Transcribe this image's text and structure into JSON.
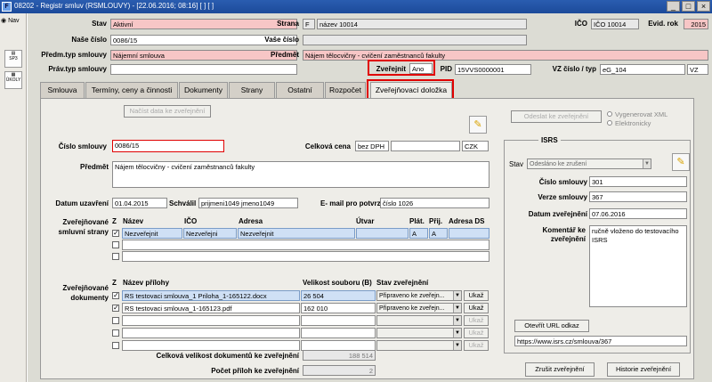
{
  "window": {
    "title": "08202 - Registr smluv (RSMLOUVY) - [22.06.2016; 08:16] [ ] [ ]"
  },
  "left": {
    "nav_label": "Nav",
    "sp3_label": "SP3",
    "ukoly_label": "ÚKOLY"
  },
  "header": {
    "stav_label": "Stav",
    "stav_value": "Aktivní",
    "strana_label": "Strana",
    "strana_code": "F",
    "strana_name": "název 10014",
    "ico_label": "IČO",
    "ico_value": "IČO 10014",
    "evid_label": "Evid. rok",
    "evid_value": "2015",
    "nase_label": "Naše číslo",
    "nase_value": "0086/15",
    "vase_label": "Vaše číslo",
    "vase_value": "",
    "predm_typ_label": "Předm.typ smlouvy",
    "predm_typ_value": "Nájemní smlouva",
    "predmet_label": "Předmět",
    "predmet_value": "Nájem tělocvičny - cvičení zaměstnanců fakulty",
    "prav_label": "Práv.typ smlouvy",
    "prav_value": "",
    "zverejnit_label": "Zveřejnit",
    "zverejnit_value": "Ano",
    "pid_label": "PID",
    "pid_value": "15VVS0000001",
    "vz_label": "VZ číslo / typ",
    "vz_value": "eG_104",
    "vz_type": "VZ"
  },
  "tabs": [
    "Smlouva",
    "Termíny, ceny a činnosti",
    "Dokumenty",
    "Strany",
    "Ostatní",
    "Rozpočet",
    "Zveřejňovací doložka"
  ],
  "panel": {
    "nacist_btn": "Načíst data ke zveřejnění",
    "odeslat_btn": "Odeslat ke zveřejnění",
    "radio_xml": "Vygenerovat XML",
    "radio_el": "Elektronicky",
    "cislo_label": "Číslo smlouvy",
    "cislo_value": "0086/15",
    "celkova_label": "Celková cena",
    "celkova_dph": "bez DPH",
    "celkova_value": "",
    "mena": "CZK",
    "predmet_label": "Předmět",
    "predmet_value": "Nájem tělocvičny - cvičení zaměstnanců fakulty",
    "datum_label": "Datum uzavření",
    "datum_value": "01.04.2015",
    "schvalil_label": "Schválil",
    "schvalil_value": "prijmeni1049 jmeno1049",
    "email_label": "E- mail pro potvrzení",
    "email_value": "číslo 1026",
    "strany_label": "Zveřejňované smluvní strany",
    "strany_cols": [
      "Z",
      "Název",
      "IČO",
      "Adresa",
      "Útvar",
      "Plát.",
      "Přij.",
      "Adresa DS"
    ],
    "strany_row": {
      "nazev": "Nezveřejnit",
      "ico": "Nezveřejni",
      "adresa": "Nezveřejnit",
      "plat": "A",
      "prij": "A"
    },
    "doc_label": "Zveřejňované dokumenty",
    "doc_cols": [
      "Z",
      "Název přílohy",
      "Velikost souboru (B)",
      "Stav zveřejnění"
    ],
    "docs": [
      {
        "name": "RS testovaci smlouva_1 Priloha_1-165122.docx",
        "size": "26 504",
        "stav": "Připraveno ke zveřejn..."
      },
      {
        "name": "RS testovaci smlouva_1-165123.pdf",
        "size": "162 010",
        "stav": "Připraveno ke zveřejn..."
      }
    ],
    "ukaz_label": "Ukaž",
    "total_label": "Celková velikost dokumentů ke zveřejnění",
    "total_value": "188 514",
    "pocet_label": "Počet příloh ke zveřejnění",
    "pocet_value": "2"
  },
  "isrs": {
    "title": "ISRS",
    "stav_label": "Stav",
    "stav_value": "Odesláno ke zrušení",
    "cislo_label": "Číslo smlouvy",
    "cislo_value": "301",
    "verze_label": "Verze smlouvy",
    "verze_value": "367",
    "datum_label": "Datum zveřejnění",
    "datum_value": "07.06.2016",
    "komentar_label": "Komentář ke zveřejnění",
    "komentar_value": "ručně vloženo do testovacího ISRS",
    "otevrit_btn": "Otevřít URL odkaz",
    "url_value": "https://www.isrs.cz/smlouva/367"
  },
  "footer": {
    "zrusit_btn": "Zrušit zveřejnění",
    "historie_btn": "Historie zveřejnění"
  }
}
